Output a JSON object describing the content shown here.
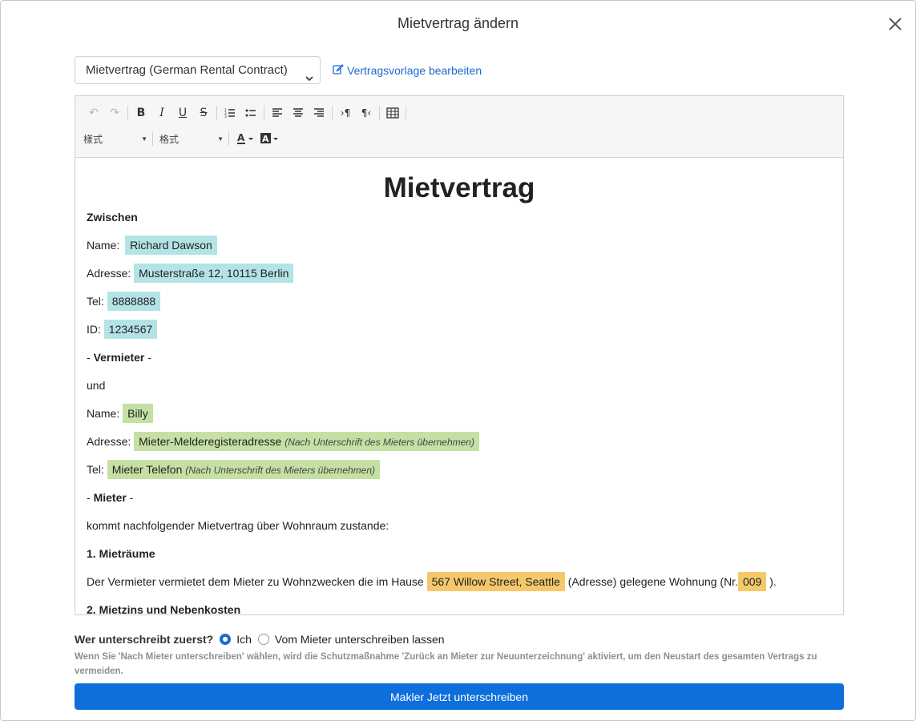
{
  "modal": {
    "title": "Mietvertrag ändern"
  },
  "template": {
    "selected": "Mietvertrag (German Rental Contract)",
    "edit_link": "Vertragsvorlage bearbeiten"
  },
  "toolbar": {
    "style_label": "樣式",
    "format_label": "格式"
  },
  "document": {
    "title": "Mietvertrag",
    "between": "Zwischen",
    "landlord": {
      "name_label": "Name:",
      "name": "Richard Dawson",
      "address_label": "Adresse:",
      "address": "Musterstraße 12, 10115 Berlin",
      "tel_label": "Tel:",
      "tel": "8888888",
      "id_label": "ID:",
      "id": "1234567",
      "role_prefix": "- ",
      "role": "Vermieter",
      "role_suffix": " -"
    },
    "and": "und",
    "tenant": {
      "name_label": "Name:",
      "name": "Billy",
      "address_label": "Adresse:",
      "address": "Mieter-Melderegisteradresse",
      "address_note": "(Nach Unterschrift des Mieters übernehmen)",
      "tel_label": "Tel:",
      "tel": "Mieter Telefon",
      "tel_note": "(Nach Unterschrift des Mieters übernehmen)",
      "role_prefix": "- ",
      "role": "Mieter",
      "role_suffix": " -"
    },
    "intro": "kommt nachfolgender Mietvertrag über Wohnraum zustande:",
    "section1": {
      "heading": "1. Mieträume",
      "text_before": "Der Vermieter vermietet dem Mieter zu Wohnzwecken die im Hause",
      "house": "567 Willow Street, Seattle",
      "text_middle": "(Adresse) gelegene Wohnung (Nr.",
      "apt": "009",
      "text_after": ")."
    },
    "section2": {
      "heading": "2. Mietzins und Nebenkosten"
    }
  },
  "signer": {
    "question": "Wer unterschreibt zuerst?",
    "option_me": "Ich",
    "option_tenant": "Vom Mieter unterschreiben lassen",
    "hint": "Wenn Sie 'Nach Mieter unterschreiben' wählen, wird die Schutzmaßnahme 'Zurück an Mieter zur Neuunterzeichnung' aktiviert, um den Neustart des gesamten Vertrags zu vermeiden."
  },
  "submit_button": "Makler Jetzt unterschreiben"
}
